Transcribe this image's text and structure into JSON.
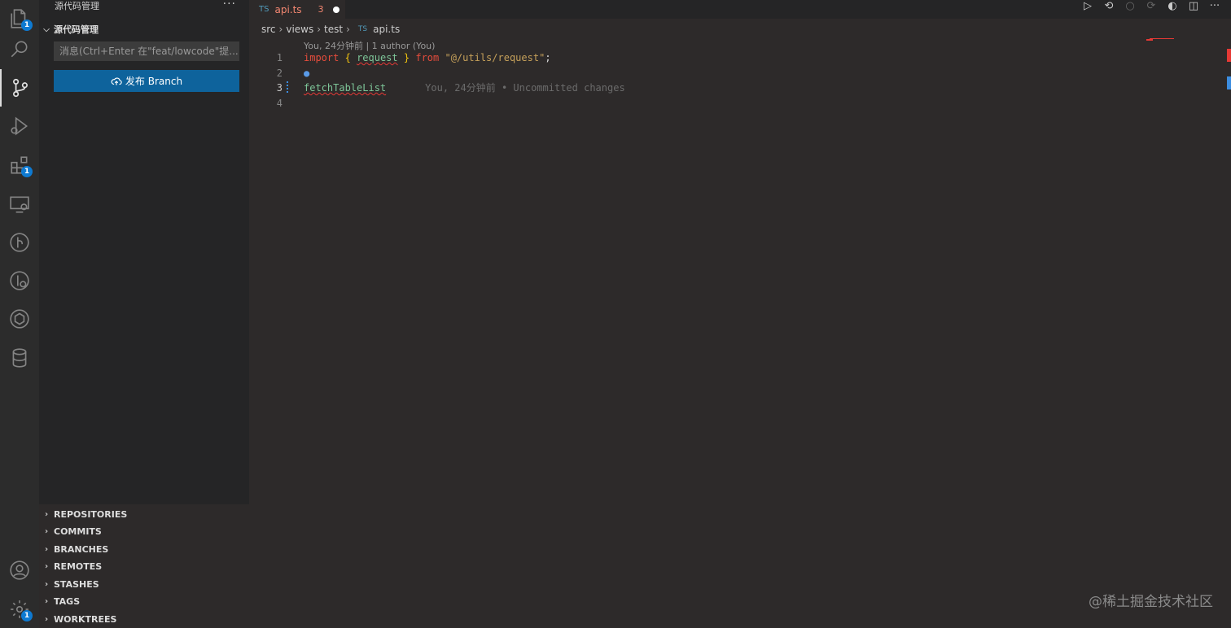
{
  "activity": {
    "explorer_badge": "1",
    "extensions_badge": "1",
    "settings_badge": "1"
  },
  "sidebar": {
    "title": "源代码管理",
    "section_title": "源代码管理",
    "message_placeholder": "消息(Ctrl+Enter 在\"feat/lowcode\"提...",
    "publish_label": "发布 Branch",
    "bottom_sections": [
      "REPOSITORIES",
      "COMMITS",
      "BRANCHES",
      "REMOTES",
      "STASHES",
      "TAGS",
      "WORKTREES"
    ]
  },
  "tab": {
    "file_type": "TS",
    "name": "api.ts",
    "problems": "3"
  },
  "breadcrumb": {
    "parts": [
      "src",
      "views",
      "test"
    ],
    "file_type": "TS",
    "file": "api.ts"
  },
  "editor": {
    "codelens": "You, 24分钟前 | 1 author (You)",
    "line_numbers": [
      "1",
      "2",
      "3",
      "4"
    ],
    "line1": {
      "kw_import": "import",
      "brace_open": "{",
      "ident": "request",
      "brace_close": "}",
      "kw_from": "from",
      "string": "\"@/utils/request\"",
      "semi": ";"
    },
    "line3_ident": "fetchTableList",
    "blame": "You, 24分钟前 • Uncommitted changes"
  },
  "watermark": "@稀土掘金技术社区"
}
